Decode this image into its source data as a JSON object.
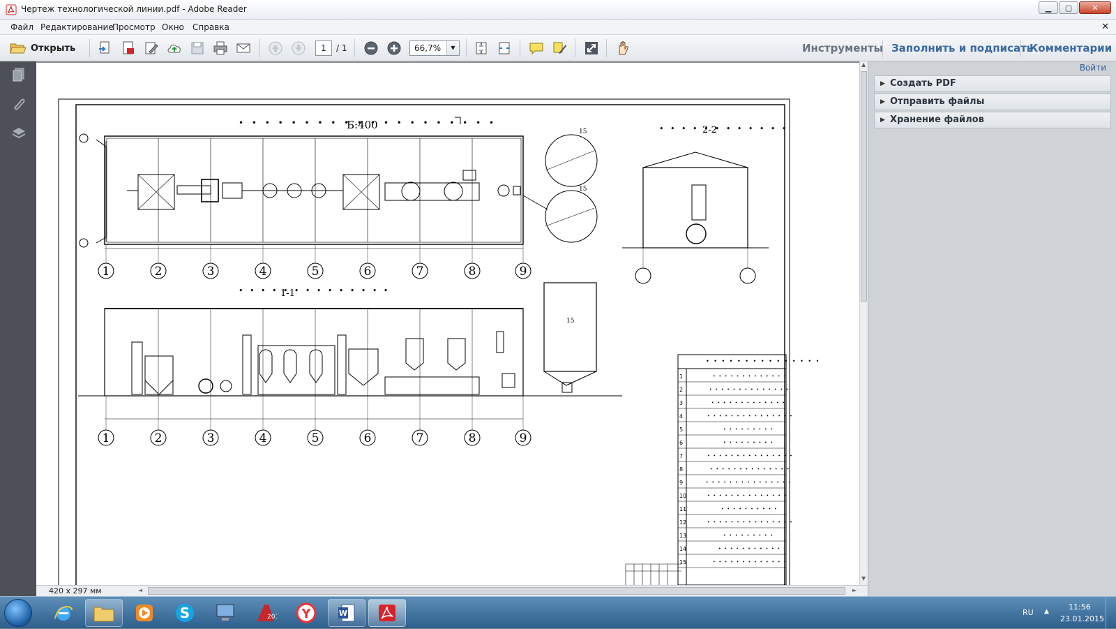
{
  "window": {
    "title": "Чертеж технологической линии.pdf - Adobe Reader",
    "controls": {
      "minimize": "▁",
      "maximize": "▢",
      "close": "✕"
    }
  },
  "menu": {
    "items": [
      "Файл",
      "Редактирование",
      "Просмотр",
      "Окно",
      "Справка"
    ],
    "close_doc": "✕"
  },
  "toolbar": {
    "open_label": "Открыть",
    "page_current": "1",
    "page_total": "/ 1",
    "zoom": "66,7%",
    "tabs": {
      "tools": "Инструменты",
      "fill_sign": "Заполнить и подписать",
      "comments": "Комментарии"
    }
  },
  "rightpane": {
    "signin": "Войти",
    "panels": [
      "Создать PDF",
      "Отправить файлы",
      "Хранение файлов"
    ]
  },
  "statusbar": {
    "page_size": "420 x 297 мм"
  },
  "drawing": {
    "plan_title": "Б:400",
    "section_22": "2-2",
    "section_11": "1-1",
    "grid_axes": [
      "1",
      "2",
      "3",
      "4",
      "5",
      "6",
      "7",
      "8",
      "9"
    ],
    "spec_rows": [
      "1",
      "2",
      "3",
      "4",
      "5",
      "6",
      "7",
      "8",
      "9",
      "10",
      "11",
      "12",
      "13",
      "14",
      "15"
    ]
  },
  "tray": {
    "lang": "RU",
    "time": "11:56",
    "date": "23.01.2015"
  },
  "colors": {
    "accent": "#3b6aa0",
    "taskbar": "#2e5e8c",
    "pdf_red": "#d8232a"
  }
}
